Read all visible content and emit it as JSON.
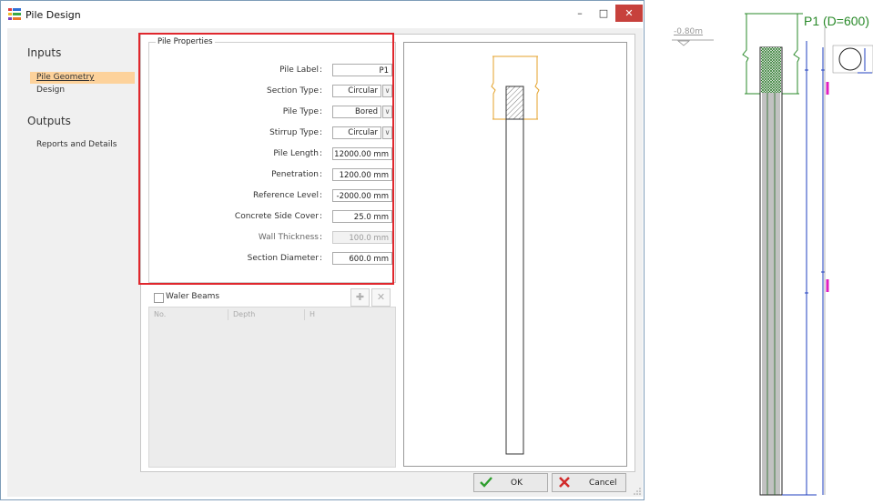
{
  "window": {
    "title": "Pile Design",
    "minimize": "–",
    "maximize": "□",
    "close": "✕"
  },
  "nav": {
    "inputs_heading": "Inputs",
    "pile_geometry": "Pile Geometry",
    "design": "Design",
    "outputs_heading": "Outputs",
    "reports": "Reports and Details"
  },
  "properties": {
    "group_title": "Pile Properties",
    "colon": ":",
    "pile_label": {
      "label": "Pile Label",
      "value": "P1"
    },
    "section_type": {
      "label": "Section Type",
      "value": "Circular"
    },
    "pile_type": {
      "label": "Pile Type",
      "value": "Bored"
    },
    "stirrup_type": {
      "label": "Stirrup Type",
      "value": "Circular"
    },
    "pile_length": {
      "label": "Pile Length",
      "value": "12000.00 mm"
    },
    "penetration": {
      "label": "Penetration",
      "value": "1200.00 mm"
    },
    "reference_level": {
      "label": "Reference Level",
      "value": "-2000.00 mm"
    },
    "side_cover": {
      "label": "Concrete Side Cover",
      "value": "25.0 mm"
    },
    "wall_thickness": {
      "label": "Wall Thickness",
      "value": "100.0 mm"
    },
    "section_diameter": {
      "label": "Section Diameter",
      "value": "600.0 mm"
    }
  },
  "waler": {
    "label": "Waler Beams",
    "checked": false,
    "add_icon": "✚",
    "remove_icon": "✕",
    "columns": [
      "No.",
      "Depth",
      "H"
    ]
  },
  "buttons": {
    "ok": "OK",
    "cancel": "Cancel"
  },
  "drawing": {
    "level_label": "-0.80m",
    "pile_title": "P1 (D=600)"
  },
  "colors": {
    "highlight": "#e0272d",
    "close_button": "#c7413c",
    "nav_selected": "#fdd29b",
    "drawing_green": "#2a8a2a",
    "drawing_blue": "#1f3fbf",
    "magenta": "#e020c0"
  }
}
